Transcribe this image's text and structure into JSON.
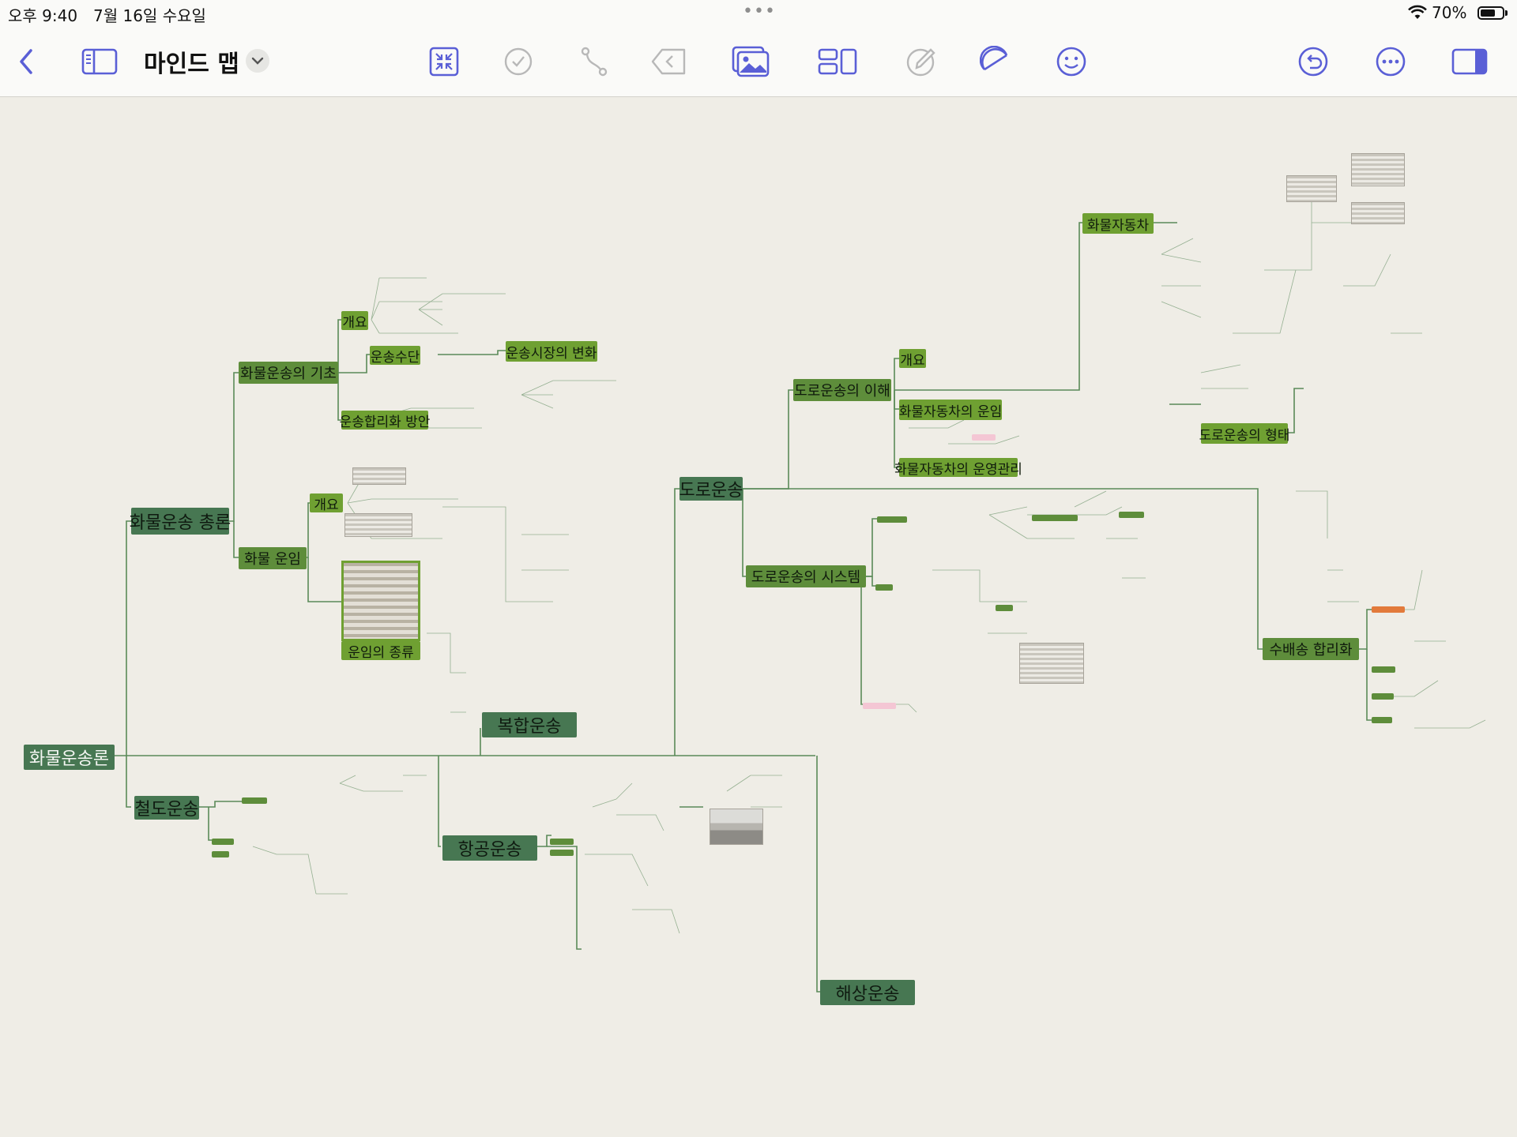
{
  "status_bar": {
    "time": "오후 9:40",
    "date": "7월 16일 수요일",
    "dots": "•••",
    "battery": "70%",
    "battery_level": 0.7
  },
  "toolbar": {
    "title": "마인드 맵",
    "icons": [
      "back-chevron-icon",
      "sidebar-icon",
      "collapse-icon",
      "checkmark-icon",
      "connection-icon",
      "back-arrow-icon",
      "image-icon",
      "layout-icon",
      "pencil-icon",
      "theme-icon",
      "emoji-icon",
      "undo-icon",
      "more-icon",
      "inspector-icon"
    ]
  },
  "colors": {
    "root": "#477752",
    "level1": "#5e8d3b",
    "level2": "#6fa032",
    "line": "#5a8a58",
    "canvas": "#efede6"
  },
  "mindmap": {
    "root": "화물운송론",
    "main": {
      "overview": "화물운송 총론",
      "road": "도로운송",
      "composite": "복합운송",
      "rail": "철도운송",
      "air": "항공운송",
      "sea": "해상운송"
    },
    "overview_children": {
      "basics": "화물운송의 기초",
      "outline": "개요",
      "modes": "운송수단",
      "market": "운송시장의 변화",
      "rational": "운송합리화 방안",
      "freight": "화물 운임",
      "freight_outline": "개요",
      "fare_types": "운임의 종류"
    },
    "road_children": {
      "understanding": "도로운송의 이해",
      "outline": "개요",
      "truck_operation": "화물자동차의 운임",
      "truck_management": "화물자동차의 운영관리",
      "trucks": "화물자동차",
      "forms": "도로운송의 형태",
      "system": "도로운송의 시스템",
      "delivery": "수배송 합리화"
    }
  }
}
